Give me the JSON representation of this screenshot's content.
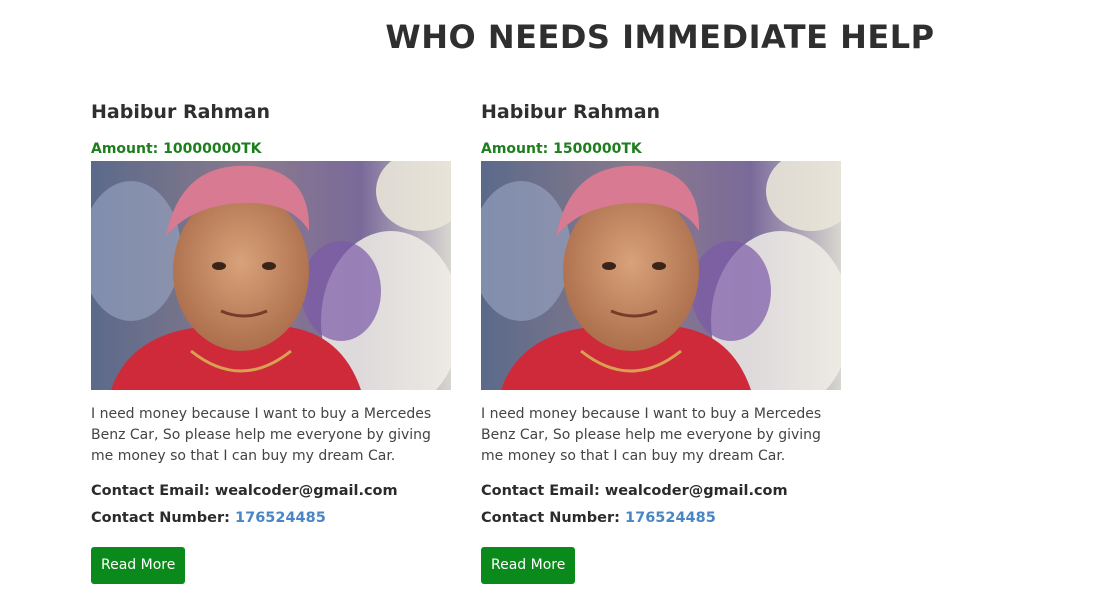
{
  "page": {
    "title": "WHO NEEDS IMMEDIATE HELP"
  },
  "cards": [
    {
      "name": "Habibur Rahman",
      "amount": "Amount: 10000000TK",
      "description": "I need money because I want to buy a Mercedes Benz Car, So please help me everyone by giving me money so that I can buy my dream Car.",
      "email_label": "Contact Email:",
      "email": "wealcoder@gmail.com",
      "number_label": "Contact Number:",
      "number": "176524485",
      "button_label": "Read More"
    },
    {
      "name": "Habibur Rahman",
      "amount": "Amount: 1500000TK",
      "description": "I need money because I want to buy a Mercedes Benz Car, So please help me everyone by giving me money so that I can buy my dream Car.",
      "email_label": "Contact Email:",
      "email": "wealcoder@gmail.com",
      "number_label": "Contact Number:",
      "number": "176524485",
      "button_label": "Read More"
    }
  ],
  "colors": {
    "amount": "#1e7e1e",
    "button": "#0a8a1a",
    "phone_link": "#4a86c5"
  }
}
